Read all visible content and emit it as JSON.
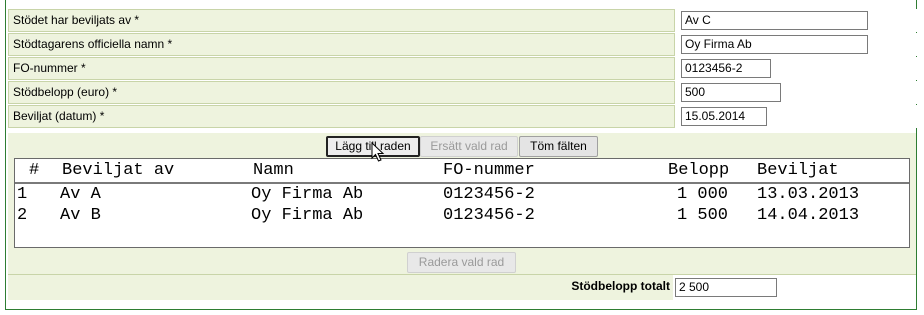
{
  "form": {
    "fields": [
      {
        "label": "Stödet har beviljats av *",
        "value": "Av C"
      },
      {
        "label": "Stödtagarens officiella namn *",
        "value": "Oy Firma Ab"
      },
      {
        "label": "FO-nummer *",
        "value": "0123456-2"
      },
      {
        "label": "Stödbelopp (euro) *",
        "value": "500"
      },
      {
        "label": "Beviljat (datum) *",
        "value": "15.05.2014"
      }
    ]
  },
  "buttons": {
    "add_row": "Lägg till raden",
    "replace_row": "Ersätt vald rad",
    "clear_fields": "Töm fälten",
    "delete_row": "Radera vald rad"
  },
  "list": {
    "headers": [
      "#",
      "Beviljat av",
      "Namn",
      "FO-nummer",
      "Belopp",
      "Beviljat"
    ],
    "rows": [
      [
        "1",
        "Av A",
        "Oy Firma Ab",
        "0123456-2",
        "1 000",
        "13.03.2013"
      ],
      [
        "2",
        "Av B",
        "Oy Firma Ab",
        "0123456-2",
        "1 500",
        "14.04.2013"
      ]
    ]
  },
  "total": {
    "label": "Stödbelopp totalt",
    "value": "2 500"
  }
}
